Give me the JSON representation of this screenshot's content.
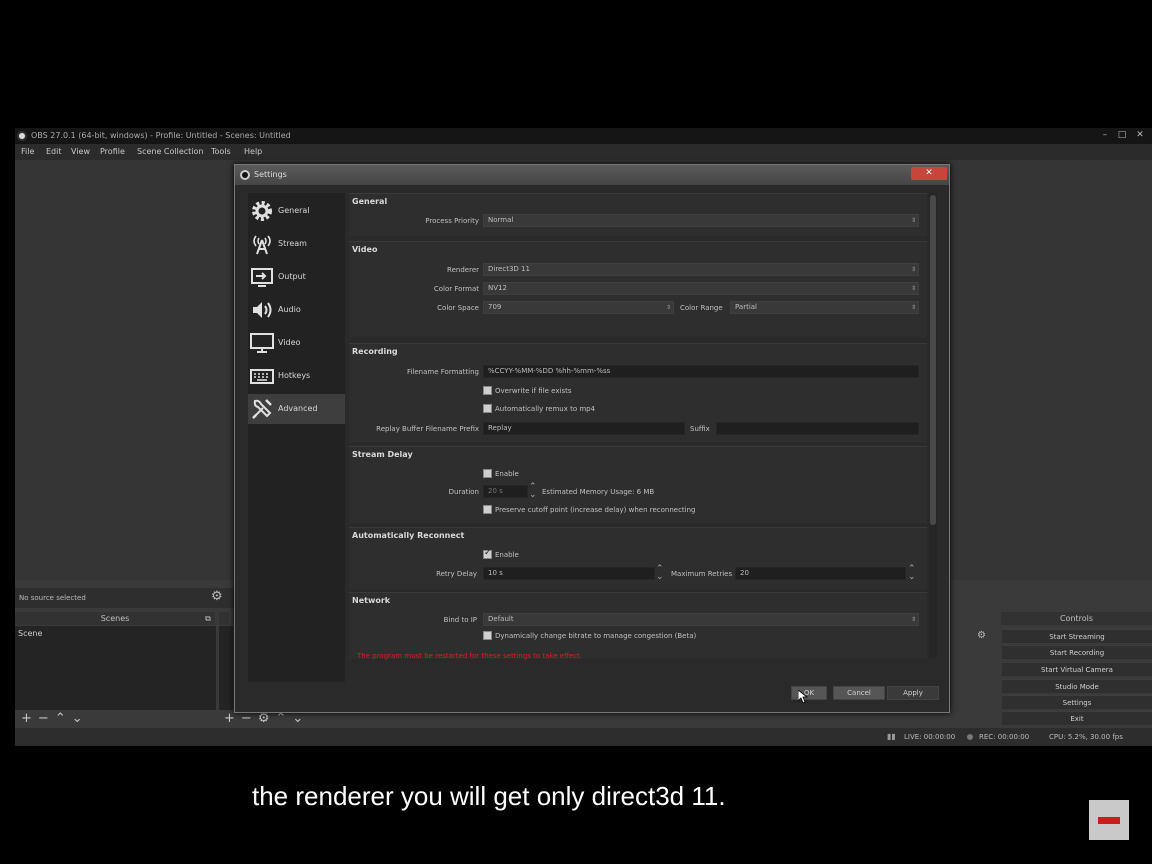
{
  "obs_window": {
    "title": "OBS 27.0.1 (64-bit, windows) - Profile: Untitled - Scenes: Untitled",
    "controls": {
      "minimize": "–",
      "maximize": "□",
      "close": "✕"
    },
    "menu": [
      "File",
      "Edit",
      "View",
      "Profile",
      "Scene Collection",
      "Tools",
      "Help"
    ],
    "source_bar": {
      "text": "No source selected"
    },
    "scenes_dock": {
      "title": "Scenes",
      "items": [
        "Scene"
      ]
    },
    "sources_dock": {
      "title": ""
    },
    "controls_dock": {
      "title": "Controls",
      "buttons": [
        "Start Streaming",
        "Start Recording",
        "Start Virtual Camera",
        "Studio Mode",
        "Settings",
        "Exit"
      ]
    },
    "status": {
      "live": "LIVE: 00:00:00",
      "rec": "REC: 00:00:00",
      "cpu": "CPU: 5.2%, 30.00 fps"
    }
  },
  "settings": {
    "title": "Settings",
    "close_label": "✕",
    "sidebar": [
      {
        "label": "General",
        "icon": "gear-icon"
      },
      {
        "label": "Stream",
        "icon": "antenna-icon"
      },
      {
        "label": "Output",
        "icon": "output-icon"
      },
      {
        "label": "Audio",
        "icon": "speaker-icon"
      },
      {
        "label": "Video",
        "icon": "monitor-icon"
      },
      {
        "label": "Hotkeys",
        "icon": "keyboard-icon"
      },
      {
        "label": "Advanced",
        "icon": "tools-icon",
        "selected": true
      }
    ],
    "general": {
      "title": "General",
      "process_priority_label": "Process Priority",
      "process_priority_value": "Normal"
    },
    "video": {
      "title": "Video",
      "renderer_label": "Renderer",
      "renderer_value": "Direct3D 11",
      "color_format_label": "Color Format",
      "color_format_value": "NV12",
      "color_space_label": "Color Space",
      "color_space_value": "709",
      "color_range_label": "Color Range",
      "color_range_value": "Partial"
    },
    "recording": {
      "title": "Recording",
      "filename_formatting_label": "Filename Formatting",
      "filename_formatting_value": "%CCYY-%MM-%DD %hh-%mm-%ss",
      "overwrite_label": "Overwrite if file exists",
      "overwrite_checked": false,
      "remux_label": "Automatically remux to mp4",
      "remux_checked": false,
      "replay_prefix_label": "Replay Buffer Filename Prefix",
      "replay_prefix_value": "Replay",
      "suffix_label": "Suffix",
      "suffix_value": ""
    },
    "stream_delay": {
      "title": "Stream Delay",
      "enable_label": "Enable",
      "enable_checked": false,
      "duration_label": "Duration",
      "duration_value": "20 s",
      "memory_usage": "Estimated Memory Usage: 6 MB",
      "preserve_label": "Preserve cutoff point (increase delay) when reconnecting",
      "preserve_checked": false
    },
    "auto_reconnect": {
      "title": "Automatically Reconnect",
      "enable_label": "Enable",
      "enable_checked": true,
      "retry_delay_label": "Retry Delay",
      "retry_delay_value": "10 s",
      "max_retries_label": "Maximum Retries",
      "max_retries_value": "20"
    },
    "network": {
      "title": "Network",
      "bind_ip_label": "Bind to IP",
      "bind_ip_value": "Default",
      "dynamic_bitrate_label": "Dynamically change bitrate to manage congestion (Beta)"
    },
    "warning": "The program must be restarted for these settings to take effect.",
    "buttons": {
      "ok": "OK",
      "cancel": "Cancel",
      "apply": "Apply"
    }
  },
  "subtitle": "the renderer you will get only direct3d 11.",
  "colors": {
    "warning": "#d62020",
    "dialog_bg": "#2a2a2a",
    "close_button": "#c8453b"
  }
}
